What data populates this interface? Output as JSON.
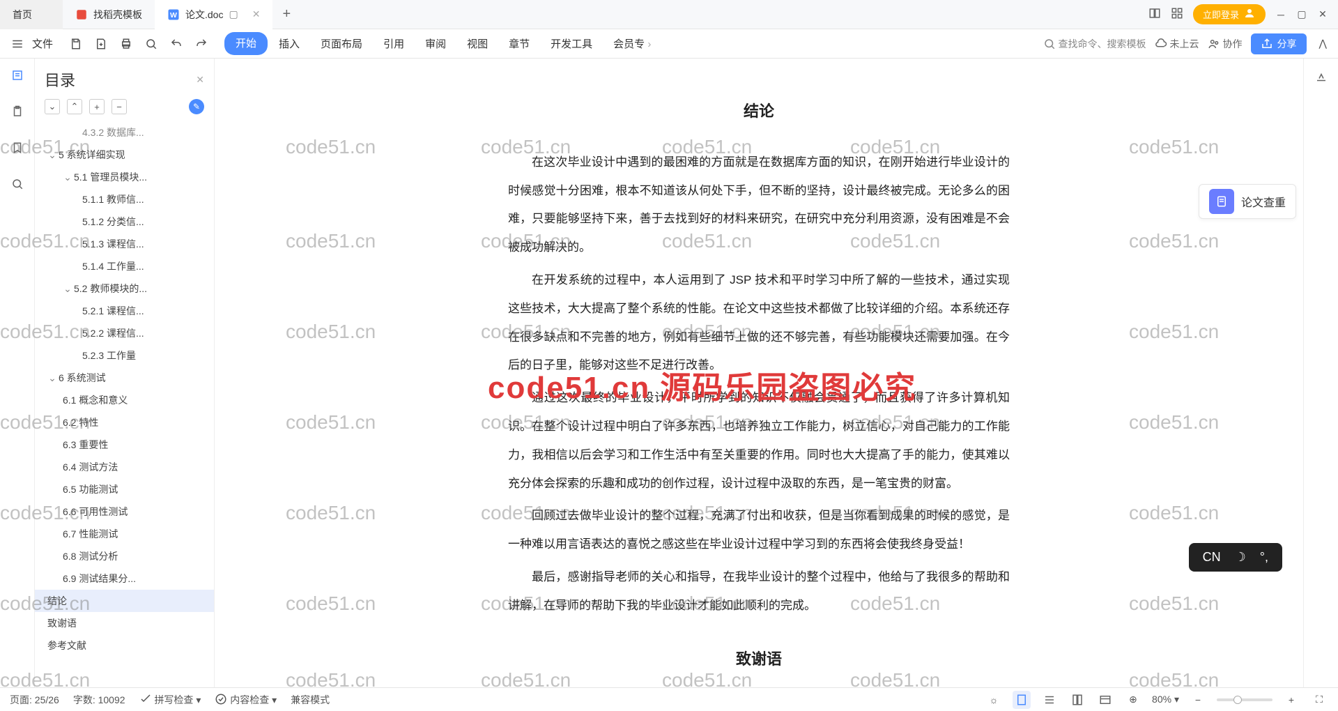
{
  "tabs": {
    "home": "首页",
    "template": "找稻壳模板",
    "doc": "论文.doc"
  },
  "login": "立即登录",
  "file_label": "文件",
  "menu": [
    "开始",
    "插入",
    "页面布局",
    "引用",
    "审阅",
    "视图",
    "章节",
    "开发工具",
    "会员专"
  ],
  "search": "查找命令、搜索模板",
  "cloud": "未上云",
  "collab": "协作",
  "share": "分享",
  "sidebar": {
    "title": "目录",
    "truncated": "4.3.2 数据库...",
    "items": [
      {
        "t": "5 系统详细实现",
        "l": 1,
        "c": 1
      },
      {
        "t": "5.1 管理员模块...",
        "l": 2,
        "c": 1
      },
      {
        "t": "5.1.1 教师信...",
        "l": 3
      },
      {
        "t": "5.1.2 分类信...",
        "l": 3
      },
      {
        "t": "5.1.3 课程信...",
        "l": 3
      },
      {
        "t": "5.1.4 工作量...",
        "l": 3
      },
      {
        "t": "5.2 教师模块的...",
        "l": 2,
        "c": 1
      },
      {
        "t": "5.2.1 课程信...",
        "l": 3
      },
      {
        "t": "5.2.2 课程信...",
        "l": 3
      },
      {
        "t": "5.2.3 工作量",
        "l": 3
      },
      {
        "t": "6 系统测试",
        "l": 1,
        "c": 1
      },
      {
        "t": "6.1 概念和意义",
        "l": 2
      },
      {
        "t": "6.2 特性",
        "l": 2
      },
      {
        "t": "6.3 重要性",
        "l": 2
      },
      {
        "t": "6.4 测试方法",
        "l": 2
      },
      {
        "t": "6.5 功能测试",
        "l": 2
      },
      {
        "t": "6.6 可用性测试",
        "l": 2
      },
      {
        "t": "6.7 性能测试",
        "l": 2
      },
      {
        "t": "6.8 测试分析",
        "l": 2
      },
      {
        "t": "6.9 测试结果分...",
        "l": 2
      },
      {
        "t": "结论",
        "l": 1,
        "sel": 1
      },
      {
        "t": "致谢语",
        "l": 1
      },
      {
        "t": "参考文献",
        "l": 1
      }
    ]
  },
  "doc": {
    "h1": "结论",
    "p1": "在这次毕业设计中遇到的最困难的方面就是在数据库方面的知识，在刚开始进行毕业设计的时候感觉十分困难，根本不知道该从何处下手，但不断的坚持，设计最终被完成。无论多么的困难，只要能够坚持下来，善于去找到好的材料来研究，在研究中充分利用资源，没有困难是不会被成功解决的。",
    "p2": "在开发系统的过程中，本人运用到了 JSP 技术和平时学习中所了解的一些技术，通过实现这些技术，大大提高了整个系统的性能。在论文中这些技术都做了比较详细的介绍。本系统还存在很多缺点和不完善的地方，例如有些细节上做的还不够完善，有些功能模块还需要加强。在今后的日子里，能够对这些不足进行改善。",
    "p3": "通过这次最终的毕业设计，平时所学到的知识不仅融会贯通了，而且获得了许多计算机知识。在整个设计过程中明白了许多东西，也培养独立工作能力，树立信心，对自己能力的工作能力，我相信以后会学习和工作生活中有至关重要的作用。同时也大大提高了手的能力，使其难以充分体会探索的乐趣和成功的创作过程，设计过程中汲取的东西，是一笔宝贵的财富。",
    "p4": "回顾过去做毕业设计的整个过程，充满了付出和收获，但是当你看到成果的时候的感觉，是一种难以用言语表达的喜悦之感这些在毕业设计过程中学习到的东西将会使我终身受益！",
    "p5": "最后，感谢指导老师的关心和指导，在我毕业设计的整个过程中，他给与了我很多的帮助和讲解，在导师的帮助下我的毕业设计才能如此顺利的完成。",
    "h2": "致谢语"
  },
  "check": "论文查重",
  "status": {
    "page": "页面: 25/26",
    "words": "字数: 10092",
    "spell": "拼写检查",
    "content": "内容检查",
    "compat": "兼容模式",
    "zoom": "80%"
  },
  "wm": "code51.cn",
  "bigwm": "code51.cn 源码乐园盗图必究",
  "ime": "CN"
}
